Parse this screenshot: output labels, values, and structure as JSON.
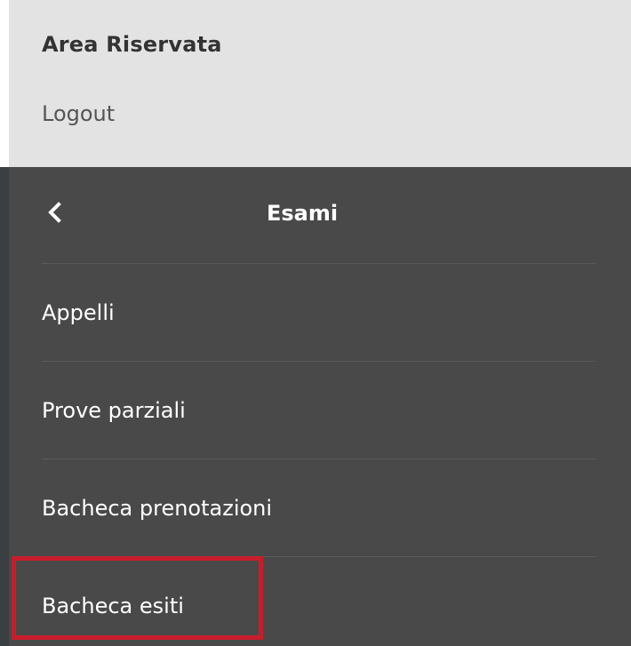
{
  "header": {
    "title": "Area Riservata",
    "logout": "Logout"
  },
  "menu": {
    "back_icon": "chevron-left-icon",
    "title": "Esami",
    "items": [
      {
        "label": "Appelli"
      },
      {
        "label": "Prove parziali"
      },
      {
        "label": "Bacheca prenotazioni"
      },
      {
        "label": "Bacheca esiti"
      }
    ]
  },
  "annotation": {
    "color": "#c91c2b",
    "target": "Bacheca esiti"
  }
}
